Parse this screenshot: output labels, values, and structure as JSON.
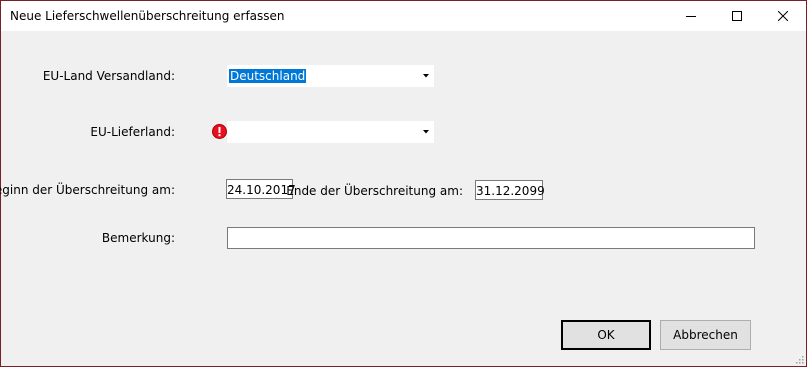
{
  "window": {
    "title": "Neue Lieferschwellenüberschreitung erfassen",
    "controls": [
      "minimize-icon",
      "maximize-icon",
      "close-icon"
    ]
  },
  "form": {
    "versandland": {
      "label": "EU-Land Versandland:",
      "value": "Deutschland"
    },
    "lieferland": {
      "label": "EU-Lieferland:",
      "value": "",
      "status_icon": "error-icon"
    },
    "beginn": {
      "label": "Beginn der Überschreitung am:",
      "value": "24.10.2017"
    },
    "ende": {
      "label": "Ende der Überschreitung am:",
      "value": "31.12.2099"
    },
    "bemerkung": {
      "label": "Bemerkung:",
      "value": ""
    }
  },
  "buttons": {
    "ok": "OK",
    "cancel": "Abbrechen"
  },
  "colors": {
    "window_border": "#7a1f2a",
    "selection": "#0078d7",
    "error": "#e81123"
  }
}
